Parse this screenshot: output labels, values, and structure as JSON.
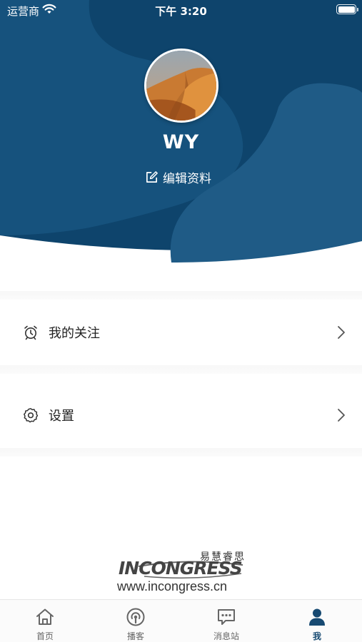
{
  "status_bar": {
    "carrier": "运营商",
    "time": "下午 3:20"
  },
  "profile": {
    "username": "WY",
    "edit_label": "编辑资料"
  },
  "menu": [
    {
      "label": "我的关注",
      "icon": "alarm-clock-icon"
    },
    {
      "label": "设置",
      "icon": "gear-icon"
    }
  ],
  "footer": {
    "brand_cn": "易慧睿思",
    "brand_en": "INCONGRESS",
    "url": "www.incongress.cn"
  },
  "tabs": [
    {
      "label": "首页",
      "icon": "home-icon",
      "active": false
    },
    {
      "label": "播客",
      "icon": "podcast-icon",
      "active": false
    },
    {
      "label": "消息站",
      "icon": "message-icon",
      "active": false
    },
    {
      "label": "我",
      "icon": "person-icon",
      "active": true
    }
  ],
  "colors": {
    "header_dark": "#0c4168",
    "header_light": "#205a83",
    "accent": "#174a72"
  }
}
